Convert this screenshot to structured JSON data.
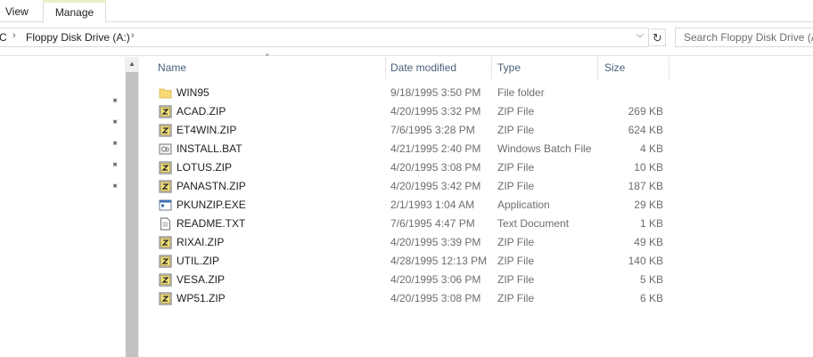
{
  "ribbon": {
    "tabs": [
      "View",
      "Manage"
    ]
  },
  "address": {
    "fragment": "C",
    "location": "Floppy Disk Drive (A:)"
  },
  "search": {
    "placeholder": "Search Floppy Disk Drive (A:)"
  },
  "columns": {
    "name": "Name",
    "date": "Date modified",
    "type": "Type",
    "size": "Size"
  },
  "files": [
    {
      "icon": "folder-icon",
      "name": "WIN95",
      "date": "9/18/1995 3:50 PM",
      "type": "File folder",
      "size": ""
    },
    {
      "icon": "zip-icon",
      "name": "ACAD.ZIP",
      "date": "4/20/1995 3:32 PM",
      "type": "ZIP File",
      "size": "269 KB"
    },
    {
      "icon": "zip-icon",
      "name": "ET4WIN.ZIP",
      "date": "7/6/1995 3:28 PM",
      "type": "ZIP File",
      "size": "624 KB"
    },
    {
      "icon": "batch-file-icon",
      "name": "INSTALL.BAT",
      "date": "4/21/1995 2:40 PM",
      "type": "Windows Batch File",
      "size": "4 KB"
    },
    {
      "icon": "zip-icon",
      "name": "LOTUS.ZIP",
      "date": "4/20/1995 3:08 PM",
      "type": "ZIP File",
      "size": "10 KB"
    },
    {
      "icon": "zip-icon",
      "name": "PANASTN.ZIP",
      "date": "4/20/1995 3:42 PM",
      "type": "ZIP File",
      "size": "187 KB"
    },
    {
      "icon": "application-icon",
      "name": "PKUNZIP.EXE",
      "date": "2/1/1993 1:04 AM",
      "type": "Application",
      "size": "29 KB"
    },
    {
      "icon": "text-document-icon",
      "name": "README.TXT",
      "date": "7/6/1995 4:47 PM",
      "type": "Text Document",
      "size": "1 KB"
    },
    {
      "icon": "zip-icon",
      "name": "RIXAI.ZIP",
      "date": "4/20/1995 3:39 PM",
      "type": "ZIP File",
      "size": "49 KB"
    },
    {
      "icon": "zip-icon",
      "name": "UTIL.ZIP",
      "date": "4/28/1995 12:13 PM",
      "type": "ZIP File",
      "size": "140 KB"
    },
    {
      "icon": "zip-icon",
      "name": "VESA.ZIP",
      "date": "4/20/1995 3:06 PM",
      "type": "ZIP File",
      "size": "5 KB"
    },
    {
      "icon": "zip-icon",
      "name": "WP51.ZIP",
      "date": "4/20/1995 3:08 PM",
      "type": "ZIP File",
      "size": "6 KB"
    }
  ]
}
